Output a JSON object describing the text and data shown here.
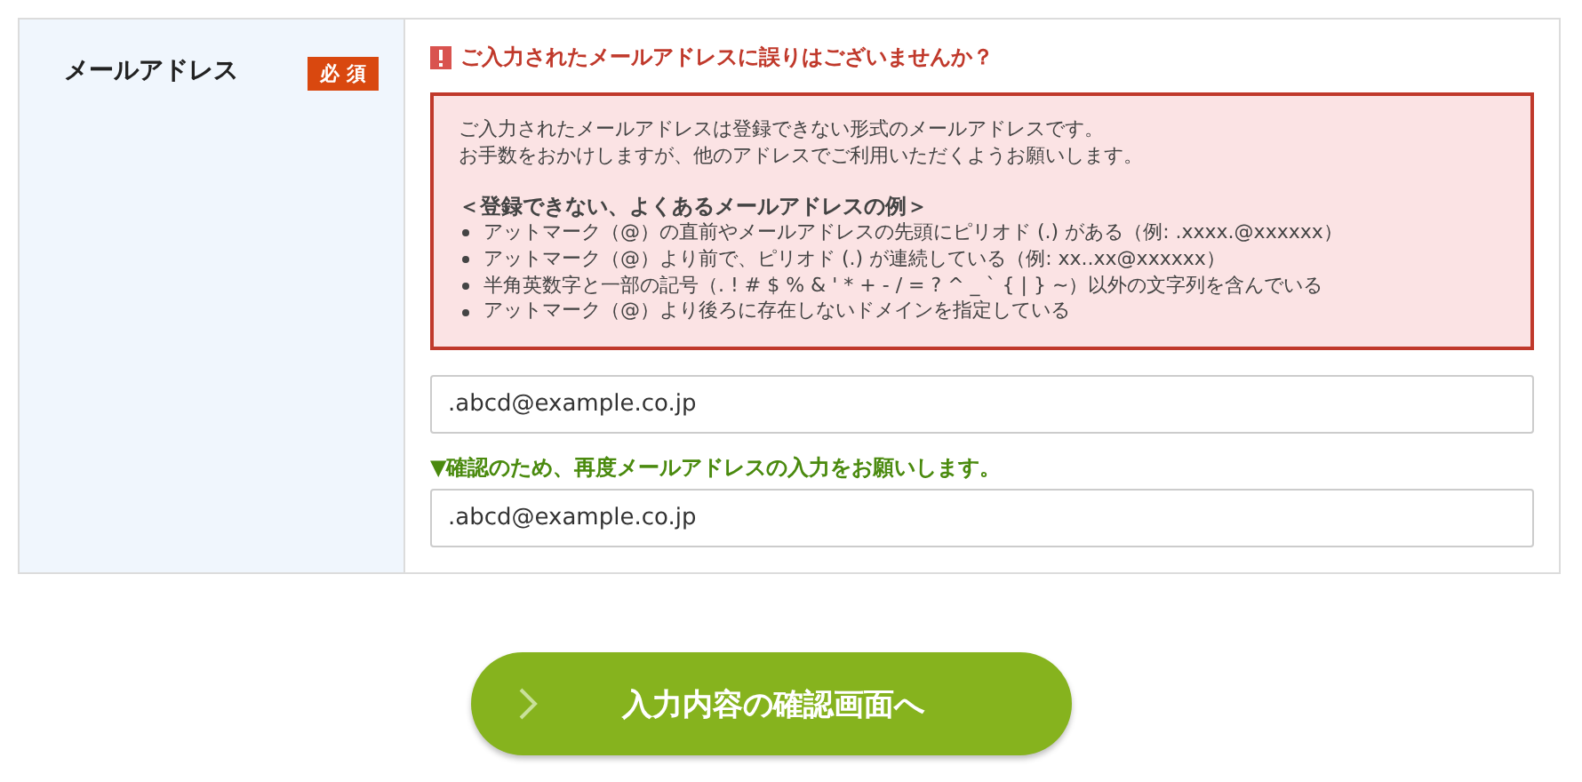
{
  "field": {
    "label": "メールアドレス",
    "badge": "必 須"
  },
  "warning": {
    "heading": "ご入力されたメールアドレスに誤りはございませんか？",
    "intro": [
      "ご入力されたメールアドレスは登録できない形式のメールアドレスです。",
      "お手数をおかけしますが、他のアドレスでご利用いただくようお願いします。"
    ],
    "examples_title": "＜登録できない、よくあるメールアドレスの例＞",
    "examples": [
      "アットマーク（@）の直前やメールアドレスの先頭にピリオド (.) がある（例: .xxxx.@xxxxxx）",
      "アットマーク（@）より前で、ピリオド (.) が連続している（例: xx..xx@xxxxxx）",
      "半角英数字と一部の記号（. ! # $ % & ' * + - / = ? ^ _ ` { | } ~）以外の文字列を含んでいる",
      "アットマーク（@）より後ろに存在しないドメインを指定している"
    ]
  },
  "email_input": {
    "value": ".abcd@example.co.jp"
  },
  "confirm_hint": "▼確認のため、再度メールアドレスの入力をお願いします。",
  "confirm_input": {
    "value": ".abcd@example.co.jp"
  },
  "submit_button": {
    "label": "入力内容の確認画面へ"
  }
}
